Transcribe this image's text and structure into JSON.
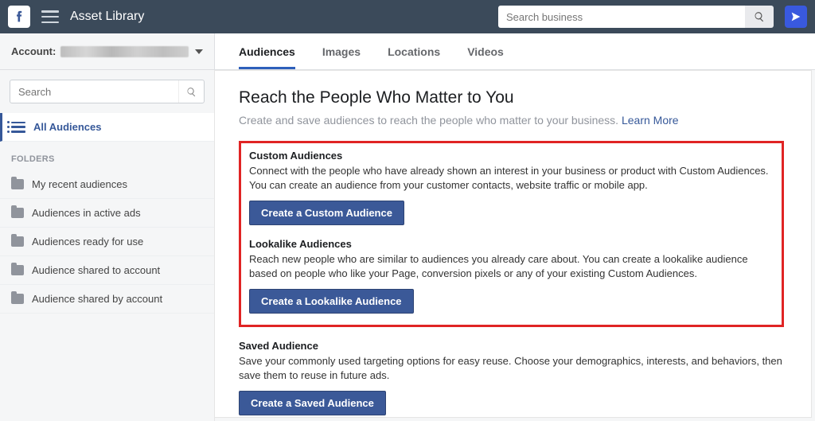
{
  "topbar": {
    "app_title": "Asset Library",
    "search_placeholder": "Search business"
  },
  "account": {
    "label": "Account:"
  },
  "tabs": [
    {
      "label": "Audiences",
      "active": true
    },
    {
      "label": "Images",
      "active": false
    },
    {
      "label": "Locations",
      "active": false
    },
    {
      "label": "Videos",
      "active": false
    }
  ],
  "sidebar": {
    "search_placeholder": "Search",
    "all_audiences": "All Audiences",
    "folders_heading": "FOLDERS",
    "folders": [
      "My recent audiences",
      "Audiences in active ads",
      "Audiences ready for use",
      "Audience shared to account",
      "Audience shared by account"
    ]
  },
  "main": {
    "title": "Reach the People Who Matter to You",
    "subtitle": "Create and save audiences to reach the people who matter to your business. ",
    "learn_more": "Learn More",
    "sections": [
      {
        "heading": "Custom Audiences",
        "body": "Connect with the people who have already shown an interest in your business or product with Custom Audiences. You can create an audience from your customer contacts, website traffic or mobile app.",
        "button": "Create a Custom Audience"
      },
      {
        "heading": "Lookalike Audiences",
        "body": "Reach new people who are similar to audiences you already care about. You can create a lookalike audience based on people who like your Page, conversion pixels or any of your existing Custom Audiences.",
        "button": "Create a Lookalike Audience"
      },
      {
        "heading": "Saved Audience",
        "body": "Save your commonly used targeting options for easy reuse. Choose your demographics, interests, and behaviors, then save them to reuse in future ads.",
        "button": "Create a Saved Audience"
      }
    ]
  }
}
